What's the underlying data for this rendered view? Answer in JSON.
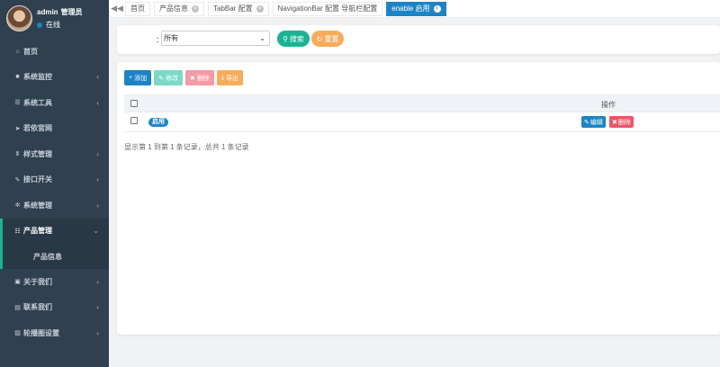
{
  "user": {
    "name": "admin",
    "role": "管理员",
    "status": "在线"
  },
  "menu": [
    {
      "label": "首页",
      "icon": "home-icon",
      "glyph": "⌂",
      "chevron": false
    },
    {
      "label": "系统监控",
      "icon": "video-camera-icon",
      "glyph": "■",
      "chevron": true
    },
    {
      "label": "系统工具",
      "icon": "bars-icon",
      "glyph": "☰",
      "chevron": true
    },
    {
      "label": "若依官网",
      "icon": "send-icon",
      "glyph": "➤",
      "chevron": false
    },
    {
      "label": "样式管理",
      "icon": "sort-icon",
      "glyph": "⇕",
      "chevron": true
    },
    {
      "label": "接口开关",
      "icon": "thumbtack-icon",
      "glyph": "✎",
      "chevron": true
    },
    {
      "label": "系统管理",
      "icon": "gear-icon",
      "glyph": "✲",
      "chevron": true
    },
    {
      "label": "产品管理",
      "icon": "list-icon",
      "glyph": "☷",
      "chevron": true,
      "expanded": true
    },
    {
      "label": "关于我们",
      "icon": "address-book-icon",
      "glyph": "▣",
      "chevron": true
    },
    {
      "label": "联系我们",
      "icon": "id-card-icon",
      "glyph": "▤",
      "chevron": true
    },
    {
      "label": "轮播图设置",
      "icon": "image-icon",
      "glyph": "▨",
      "chevron": true
    }
  ],
  "submenu": {
    "label": "产品信息"
  },
  "tabs": [
    {
      "label": "首页",
      "closable": false,
      "active": false
    },
    {
      "label": "产品信息",
      "closable": true,
      "active": false
    },
    {
      "label": "TabBar 配置",
      "closable": true,
      "active": false
    },
    {
      "label": "NavigationBar 配置  导航栏配置",
      "closable": false,
      "active": false
    },
    {
      "label": "enable  启用",
      "closable": true,
      "active": true
    }
  ],
  "search": {
    "label": "：",
    "select_value": "所有",
    "search_button": "搜索",
    "reset_button": "重置"
  },
  "toolbar": {
    "add": "添加",
    "edit": "修改",
    "delete": "删除",
    "export": "导出"
  },
  "table": {
    "header_op": "操作",
    "rows": [
      {
        "status": "启用",
        "edit": "编辑",
        "delete": "删除"
      }
    ],
    "pagination": "显示第 1 到第 1 条记录，总共 1 条记录"
  },
  "colors": {
    "sidebar": "#2f4050",
    "primary": "#1c84c6",
    "success": "#1ab394",
    "warning": "#f8ac59",
    "danger": "#ed5565"
  }
}
